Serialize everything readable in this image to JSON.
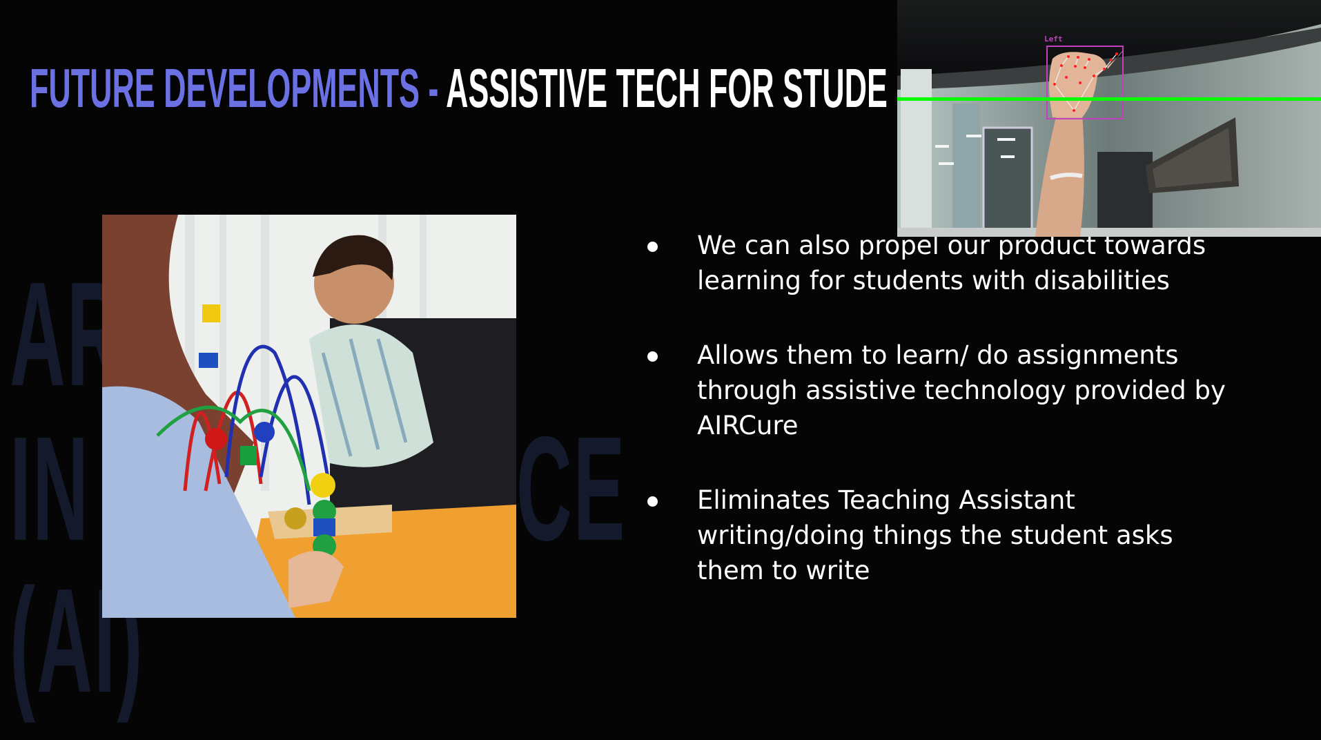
{
  "slide": {
    "title_accent": "FUTURE DEVELOPMENTS - ",
    "title_main": "ASSISTIVE TECH FOR STUDE",
    "background_words": [
      "AR",
      "IN",
      "CE",
      "(AI)"
    ],
    "bullets": [
      "We can also propel our product towards learning for students with disabilities",
      "Allows them to learn/ do assignments through assistive technology provided by AIRCure",
      "Eliminates Teaching Assistant writing/doing things the student asks them to write"
    ]
  },
  "webcam": {
    "hand_label": "Left",
    "colors": {
      "guide_line": "#00ff00",
      "box": "#c040c0",
      "landmark": "#ff2020"
    }
  },
  "colors": {
    "accent": "#6b70e3",
    "background": "#050505",
    "watermark": "#141a2c"
  }
}
